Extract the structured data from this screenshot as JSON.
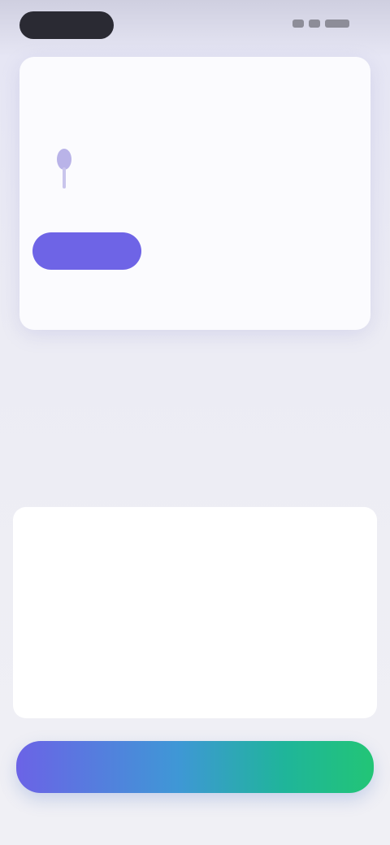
{
  "status_bar": {
    "time": ""
  },
  "top_card": {
    "label": "",
    "link": "",
    "sub_label": "",
    "sub_right": "",
    "profile_name": "",
    "profile_sub": "",
    "segments": [
      {
        "label": ""
      },
      {
        "label": ""
      },
      {
        "label": ""
      }
    ],
    "note": ""
  },
  "section_one": {
    "title": "",
    "row_text": "",
    "row_action": ""
  },
  "section_two": {
    "title": "",
    "items": [
      {
        "label": ""
      },
      {
        "label": ""
      },
      {
        "label": ""
      },
      {
        "label": ""
      }
    ]
  },
  "primary_button": {
    "label": ""
  },
  "colors": {
    "accent": "#6e64e6",
    "gradient_start": "#6b63e6",
    "gradient_end": "#22c576"
  }
}
